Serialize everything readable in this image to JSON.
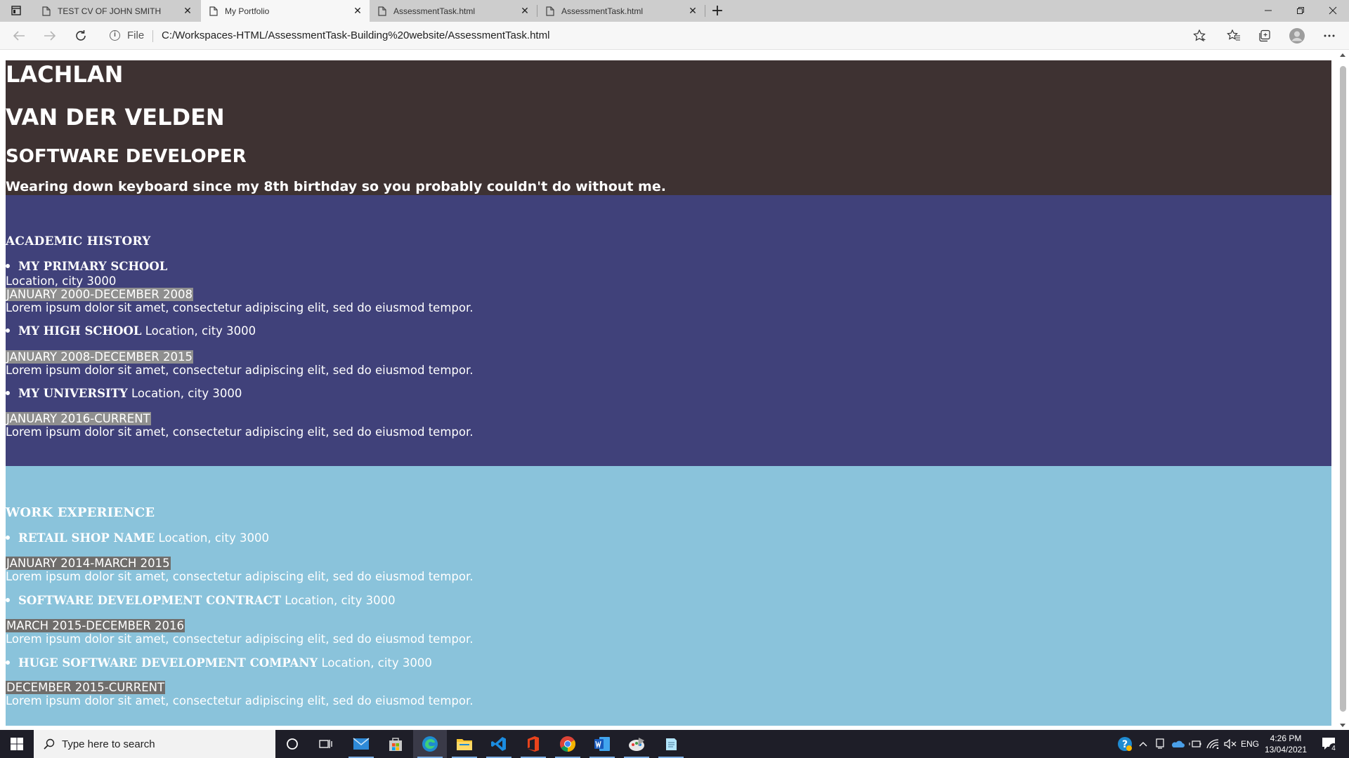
{
  "browser": {
    "tabs": [
      {
        "title": "TEST CV OF JOHN SMITH",
        "active": false
      },
      {
        "title": "My Portfolio",
        "active": true
      },
      {
        "title": "AssessmentTask.html",
        "active": false
      },
      {
        "title": "AssessmentTask.html",
        "active": false
      }
    ],
    "close_glyph": "✕",
    "new_tab_glyph": "+",
    "url_scheme_label": "File",
    "url": "C:/Workspaces-HTML/AssessmentTask-Building%20website/AssessmentTask.html"
  },
  "page": {
    "header": {
      "first_name": "LACHLAN",
      "last_name": "VAN DER VELDEN",
      "role": "SOFTWARE DEVELOPER",
      "tagline": "Wearing down keyboard since my 8th birthday so you probably couldn't do without me."
    },
    "academic": {
      "title": "ACADEMIC HISTORY",
      "entries": [
        {
          "org": "MY PRIMARY SCHOOL",
          "location": "Location, city 3000",
          "date": "JANUARY 2000-DECEMBER 2008",
          "desc": "Lorem ipsum dolor sit amet, consectetur adipiscing elit, sed do eiusmod tempor."
        },
        {
          "org": "MY HIGH SCHOOL",
          "location": "Location, city 3000",
          "date": "JANUARY 2008-DECEMBER 2015",
          "desc": "Lorem ipsum dolor sit amet, consectetur adipiscing elit, sed do eiusmod tempor."
        },
        {
          "org": "MY UNIVERSITY",
          "location": "Location, city 3000",
          "date": "JANUARY 2016-CURRENT",
          "desc": "Lorem ipsum dolor sit amet, consectetur adipiscing elit, sed do eiusmod tempor."
        }
      ]
    },
    "work": {
      "title": "WORK EXPERIENCE",
      "entries": [
        {
          "org": "RETAIL SHOP NAME",
          "location": "Location, city 3000",
          "date": "JANUARY 2014-MARCH 2015",
          "desc": "Lorem ipsum dolor sit amet, consectetur adipiscing elit, sed do eiusmod tempor."
        },
        {
          "org": "SOFTWARE DEVELOPMENT CONTRACT",
          "location": "Location, city 3000",
          "date": "MARCH 2015-DECEMBER 2016",
          "desc": "Lorem ipsum dolor sit amet, consectetur adipiscing elit, sed do eiusmod tempor."
        },
        {
          "org": "HUGE SOFTWARE DEVELOPMENT COMPANY",
          "location": "Location, city 3000",
          "date": "DECEMBER 2015-CURRENT",
          "desc": "Lorem ipsum dolor sit amet, consectetur adipiscing elit, sed do eiusmod tempor."
        }
      ]
    },
    "colors": {
      "header_bg": "#3e3232",
      "academic_bg": "#40417a",
      "work_bg": "#8ac3db",
      "text": "#ffffff"
    }
  },
  "taskbar": {
    "search_placeholder": "Type here to search",
    "language": "ENG",
    "time": "4:26 PM",
    "date": "13/04/2021",
    "notification_count": "4",
    "apps": [
      "cortana-icon",
      "task-view-icon",
      "mail-icon",
      "store-icon",
      "edge-icon",
      "file-explorer-icon",
      "vscode-icon",
      "office-icon",
      "chrome-icon",
      "word-icon",
      "paint-icon",
      "notepad-icon"
    ]
  }
}
